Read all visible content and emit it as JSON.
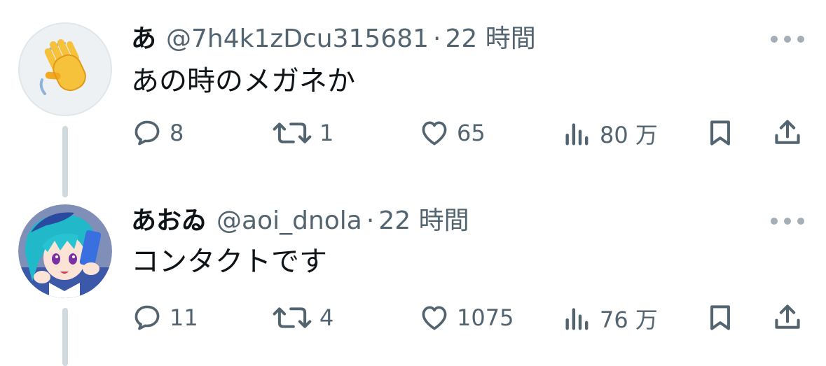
{
  "colors": {
    "text_primary": "#0f1419",
    "text_secondary": "#536471",
    "thread_line": "#cfd9de"
  },
  "tweets": [
    {
      "display_name": "あ",
      "handle": "@7h4k1zDcu315681",
      "separator": "·",
      "time": "22 時間",
      "text": "あの時のメガネか",
      "avatar_icon": "waving-hand-emoji",
      "stats": {
        "replies": "8",
        "retweets": "1",
        "likes": "65",
        "views": "80 万"
      }
    },
    {
      "display_name": "あおゐ",
      "handle": "@aoi_dnola",
      "separator": "·",
      "time": "22 時間",
      "text": "コンタクトです",
      "avatar_icon": "anime-character-avatar",
      "stats": {
        "replies": "11",
        "retweets": "4",
        "likes": "1075",
        "views": "76 万"
      }
    }
  ]
}
